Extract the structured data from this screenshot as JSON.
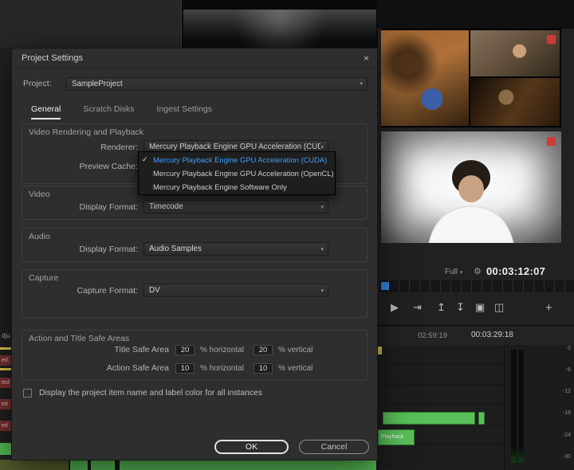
{
  "icons": {
    "close": "×",
    "chevron_down": "▾",
    "check": "✓",
    "play": "▶",
    "step_forward": "⇥",
    "lift": "↥",
    "extract": "↧",
    "export_frame": "▣",
    "compare": "◫",
    "plus": "+",
    "wrench": "⚙"
  },
  "colors": {
    "accent_blue": "#3f9eff",
    "clip_green": "#58bf58",
    "marker_yellow": "#e8d44c",
    "record_red": "#cf3b3b"
  },
  "dialog": {
    "title": "Project Settings",
    "project": {
      "label": "Project:",
      "value": "SampleProject"
    },
    "tabs": [
      {
        "label": "General"
      },
      {
        "label": "Scratch Disks"
      },
      {
        "label": "Ingest Settings"
      }
    ],
    "rendering": {
      "title": "Video Rendering and Playback",
      "renderer_label": "Renderer:",
      "renderer_value": "Mercury Playback Engine GPU Acceleration (CUDA)",
      "preview_cache_label": "Preview Cache:",
      "menu": {
        "items": [
          {
            "label": "Mercury Playback Engine GPU Acceleration (CUDA)",
            "checked": true
          },
          {
            "label": "Mercury Playback Engine GPU Acceleration (OpenCL)",
            "checked": false
          },
          {
            "label": "Mercury Playback Engine Software Only",
            "checked": false
          }
        ]
      }
    },
    "video": {
      "title": "Video",
      "label": "Display Format:",
      "value": "Timecode"
    },
    "audio": {
      "title": "Audio",
      "label": "Display Format:",
      "value": "Audio Samples"
    },
    "capture": {
      "title": "Capture",
      "label": "Capture Format:",
      "value": "DV"
    },
    "safe_areas": {
      "title": "Action and Title Safe Areas",
      "rows": [
        {
          "label": "Title Safe Area",
          "horizontal": "20",
          "vertical": "20"
        },
        {
          "label": "Action Safe Area",
          "horizontal": "10",
          "vertical": "10"
        }
      ],
      "horizontal_suffix": "% horizontal",
      "vertical_suffix": "% vertical"
    },
    "display_checkbox_label": "Display the project item name and label color for all instances",
    "buttons": {
      "ok": "OK",
      "cancel": "Cancel"
    }
  },
  "monitor": {
    "zoom_value": "Full",
    "timecode": "00:03:12:07"
  },
  "timeline": {
    "timecode_in": "02:59:19",
    "timecode_out": "00:03:29:18",
    "clip_label": "Playback",
    "left_fragments": [
      "dju",
      "ed.",
      "ted",
      "ed",
      "ed"
    ]
  },
  "meters": {
    "labels": [
      "0",
      "-6",
      "-12",
      "-18",
      "-24",
      "-30"
    ]
  }
}
